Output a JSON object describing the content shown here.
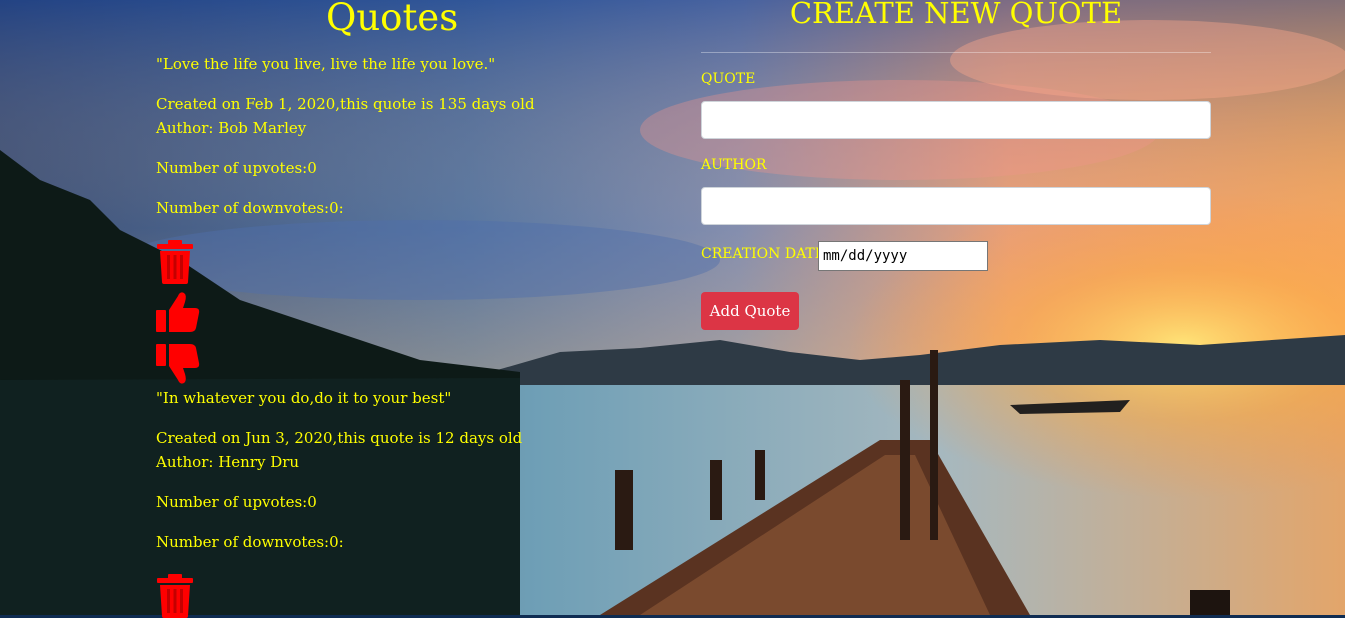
{
  "page": {
    "title": "Quotes"
  },
  "quotes": [
    {
      "text": "\"Love the life you live, live the life you love.\"",
      "created": "Created on Feb 1, 2020,this quote is 135 days old",
      "author": "Author: Bob Marley",
      "upvotes": "Number of upvotes:0",
      "downvotes": "Number of downvotes:0:"
    },
    {
      "text": "\"In whatever you do,do it to your best\"",
      "created": "Created on Jun 3, 2020,this quote is 12 days old",
      "author": "Author: Henry Dru",
      "upvotes": "Number of upvotes:0",
      "downvotes": "Number of downvotes:0:"
    }
  ],
  "form": {
    "title": "CREATE NEW QUOTE",
    "quote_label": "QUOTE",
    "quote_value": "",
    "author_label": "AUTHOR",
    "author_value": "",
    "date_label": "CREATION DATE",
    "date_placeholder": "mm/dd/yyyy",
    "submit_label": "Add Quote"
  },
  "icons": {
    "delete": "trash-icon",
    "upvote": "thumbs-up-icon",
    "downvote": "thumbs-down-icon"
  },
  "colors": {
    "text": "#ffff00",
    "icon": "#ff0000",
    "button": "#dc3545"
  }
}
